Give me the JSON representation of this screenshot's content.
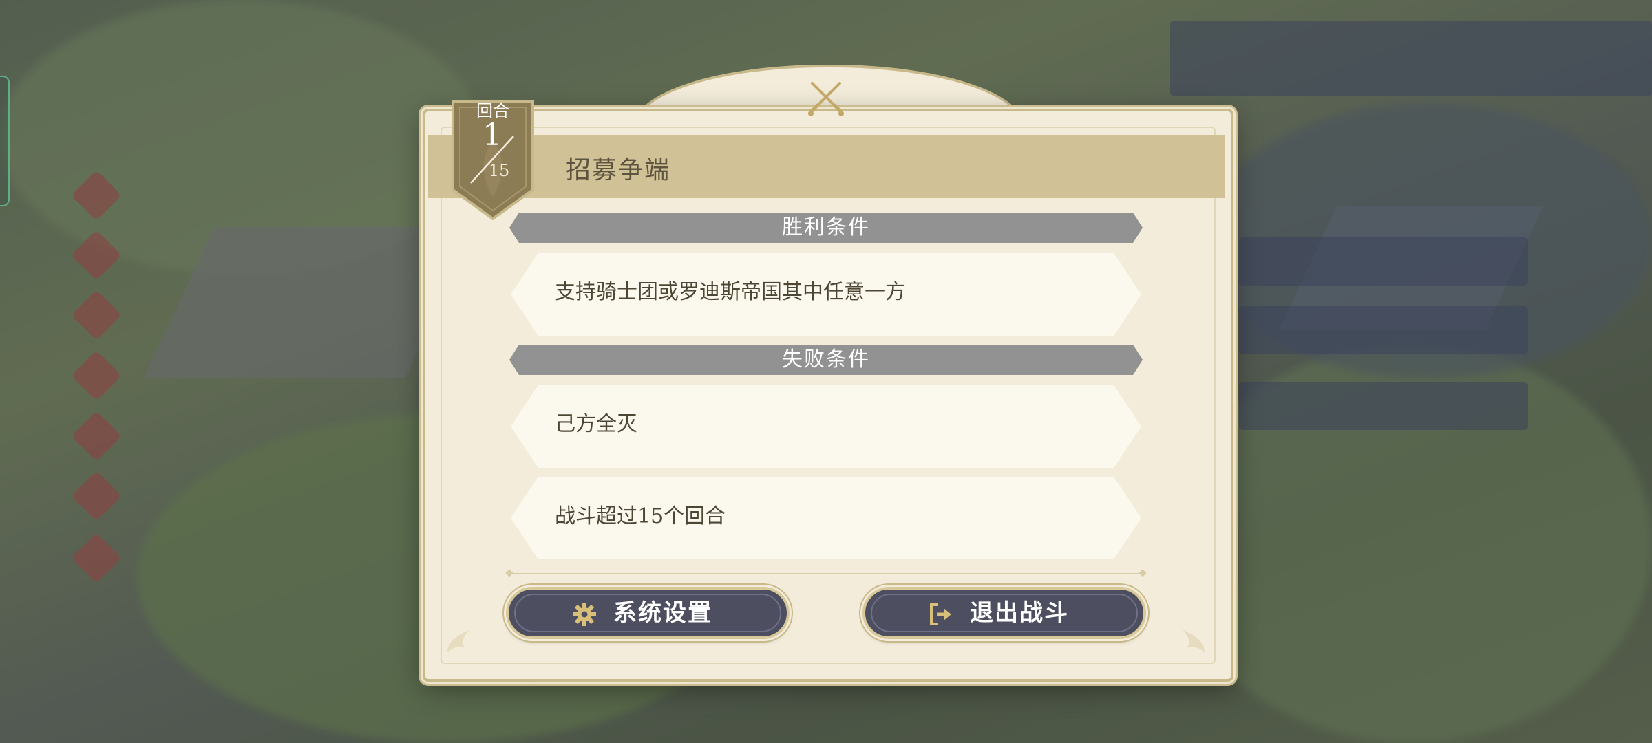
{
  "dialog": {
    "round": {
      "label": "回合",
      "current": "1",
      "total": "15"
    },
    "title": "招募争端",
    "crest_icon": "crossed-swords-icon",
    "victory": {
      "header": "胜利条件",
      "conditions": [
        "支持骑士团或罗迪斯帝国其中任意一方"
      ]
    },
    "defeat": {
      "header": "失败条件",
      "conditions": [
        "己方全灭",
        "战斗超过15个回合"
      ]
    },
    "buttons": {
      "settings": {
        "label": "系统设置",
        "icon": "gear-icon"
      },
      "exit": {
        "label": "退出战斗",
        "icon": "exit-icon"
      }
    }
  },
  "colors": {
    "panel_bg": "#f3ecda",
    "title_bar": "#d1c196",
    "section_header": "#929292",
    "button_bg": "#4d4f60",
    "gold": "#c8b98a",
    "icon_gold": "#d9c07a"
  }
}
